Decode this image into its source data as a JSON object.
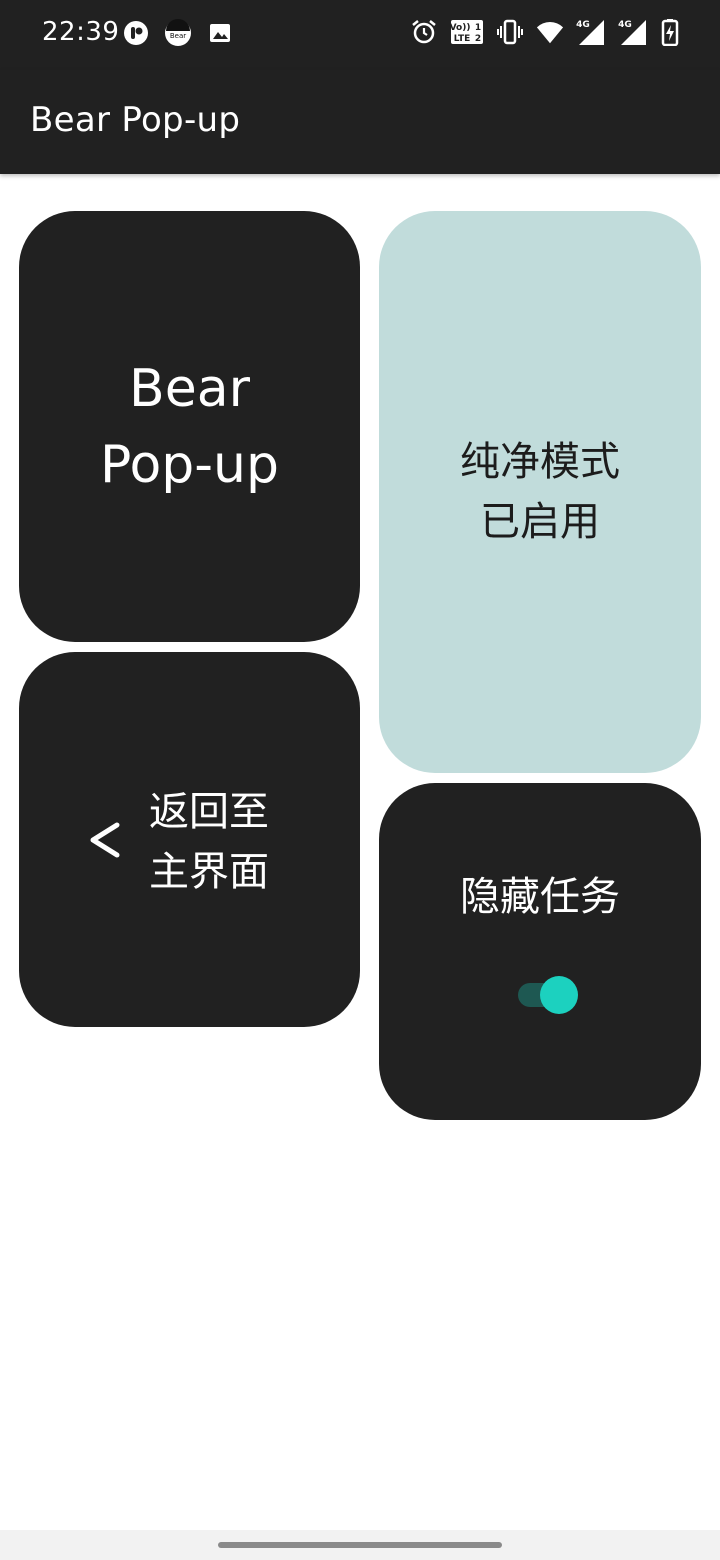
{
  "status_bar": {
    "time": "22:39",
    "left_icons": [
      "app-notification-icon",
      "bear-app-icon",
      "image-icon"
    ],
    "bear_icon_text": "Bear",
    "right_icons": [
      "alarm-icon",
      "volte-icon",
      "vibrate-icon",
      "wifi-icon",
      "signal-4g-icon",
      "signal-4g-icon",
      "battery-charging-icon"
    ],
    "volte_line1": "Vo))",
    "volte_line2": "LTE",
    "sim1": "1",
    "sim2": "2",
    "net1": "4G",
    "net2": "4G"
  },
  "app_bar": {
    "title": "Bear Pop-up"
  },
  "tiles": {
    "brand": {
      "line1": "Bear",
      "line2": "Pop-up"
    },
    "pure_mode": {
      "line1": "纯净模式",
      "line2": "已启用"
    },
    "back_home": {
      "arrow": "<",
      "line1": "返回至",
      "line2": "主界面"
    },
    "hide_task": {
      "label": "隐藏任务",
      "toggle_on": true
    }
  },
  "colors": {
    "bar": "#212121",
    "tile_dark": "#212121",
    "tile_light": "#c1dcdb",
    "toggle_track": "#1e5852",
    "toggle_thumb": "#1cd1bf"
  }
}
